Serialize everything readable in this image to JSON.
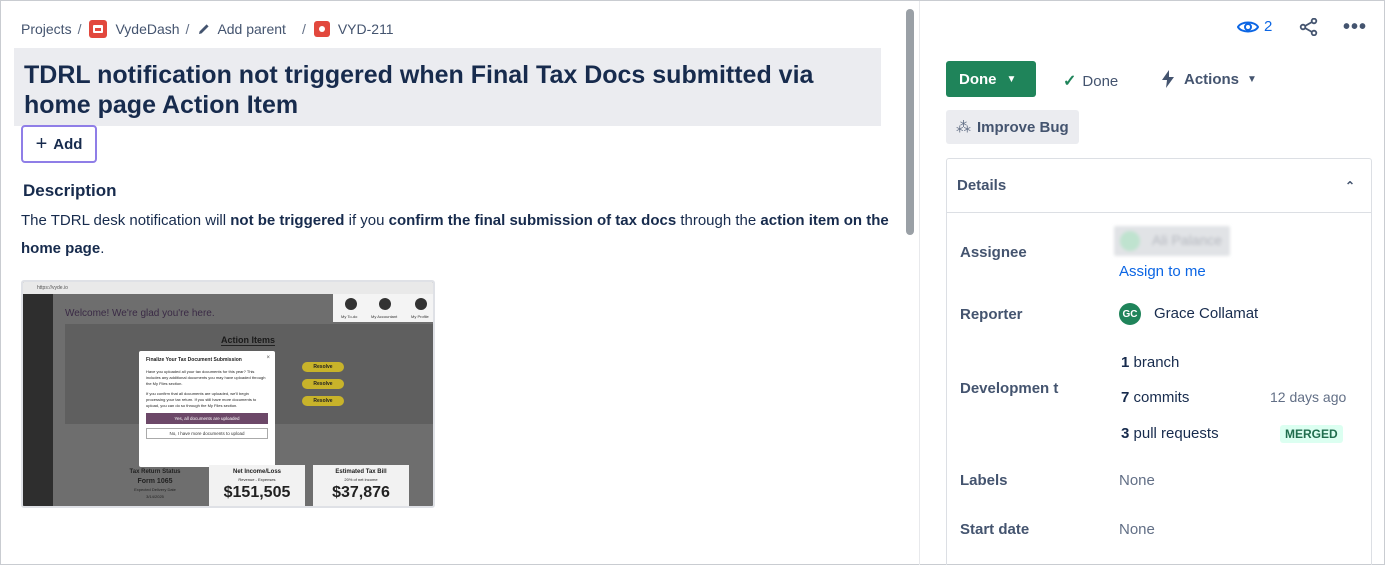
{
  "breadcrumb": {
    "projects": "Projects",
    "project_name": "VydeDash",
    "add_parent": "Add parent",
    "issue_key": "VYD-211"
  },
  "issue": {
    "title": "TDRL notification not triggered when Final Tax Docs submitted via home page Action Item",
    "add_button": "Add",
    "description_heading": "Description",
    "description": {
      "p1": "The TDRL desk notification will ",
      "b1": "not be triggered",
      "p2": " if you ",
      "b2": "confirm the final submission of tax docs",
      "p3": " through the ",
      "b3": "action item on the home page",
      "p4": "."
    }
  },
  "screenshot": {
    "url": "https://vyde.io",
    "welcome": "Welcome! We're glad you're here.",
    "top_labels": [
      "My To-do",
      "My Accountant",
      "My Profile"
    ],
    "action_items_title": "Action Items",
    "resolve_label": "Resolve",
    "modal": {
      "title": "Finalize Your Tax Document Submission",
      "close": "×",
      "p1": "Have you uploaded all your tax documents for this year? This includes any additional documents you may have uploaded through the My Files section.",
      "p2": "If you confirm that all documents are uploaded, we'll begin processing your tax return. If you still have more documents to upload, you can do so through the My Files section.",
      "primary": "Yes, all documents are uploaded",
      "secondary": "No, I have more documents to upload"
    },
    "cards": [
      {
        "title": "Tax Return Status",
        "line1": "Form 1065",
        "line2": "Expected Delivery Date",
        "line3": "3/14/2025"
      },
      {
        "title": "Net Income/Loss",
        "sub": "Revenue - Expenses",
        "big": "$151,505"
      },
      {
        "title": "Estimated Tax Bill",
        "sub": "20% of net income",
        "big": "$37,876"
      }
    ]
  },
  "sidebar": {
    "watchers": "2",
    "status": "Done",
    "resolution": "Done",
    "actions": "Actions",
    "improve": "Improve Bug",
    "details_title": "Details",
    "fields": {
      "assignee_label": "Assignee",
      "assignee_name": "Ali Palance",
      "assign_to_me": "Assign to me",
      "reporter_label": "Reporter",
      "reporter_initials": "GC",
      "reporter_name": "Grace Collamat",
      "development_label": "Developmen t",
      "branch_count": "1",
      "branch_text": "branch",
      "commit_count": "7",
      "commit_text": "commits",
      "commit_time": "12 days ago",
      "pr_count": "3",
      "pr_text": "pull requests",
      "pr_status": "MERGED",
      "labels_label": "Labels",
      "labels_value": "None",
      "start_date_label": "Start date",
      "start_date_value": "None"
    }
  },
  "colors": {
    "status_green": "#1f845a",
    "link_blue": "#0c66e4",
    "focus_purple": "#8f7ee7",
    "project_red": "#e2483d"
  }
}
